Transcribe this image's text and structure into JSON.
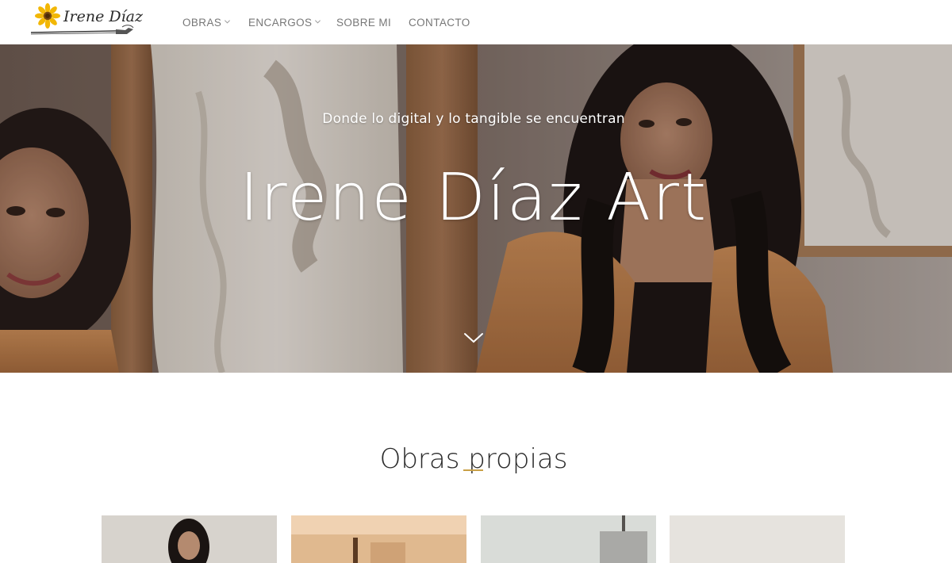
{
  "brand": {
    "name": "Irene Díaz"
  },
  "nav": {
    "items": [
      {
        "label": "OBRAS",
        "has_dropdown": true
      },
      {
        "label": "ENCARGOS",
        "has_dropdown": true
      },
      {
        "label": "SOBRE MI",
        "has_dropdown": false
      },
      {
        "label": "CONTACTO",
        "has_dropdown": false
      }
    ]
  },
  "hero": {
    "subtitle": "Donde lo digital y lo tangible se encuentran",
    "title": "Irene Díaz Art"
  },
  "section": {
    "title": "Obras propias"
  },
  "colors": {
    "accent": "#c9a046",
    "nav_text": "#777777",
    "title_text": "#2b2b2b"
  },
  "icons": {
    "logo": "sunflower-paintbrush-logo",
    "dropdown": "chevron-down-icon",
    "scroll_down": "chevron-down-icon"
  }
}
